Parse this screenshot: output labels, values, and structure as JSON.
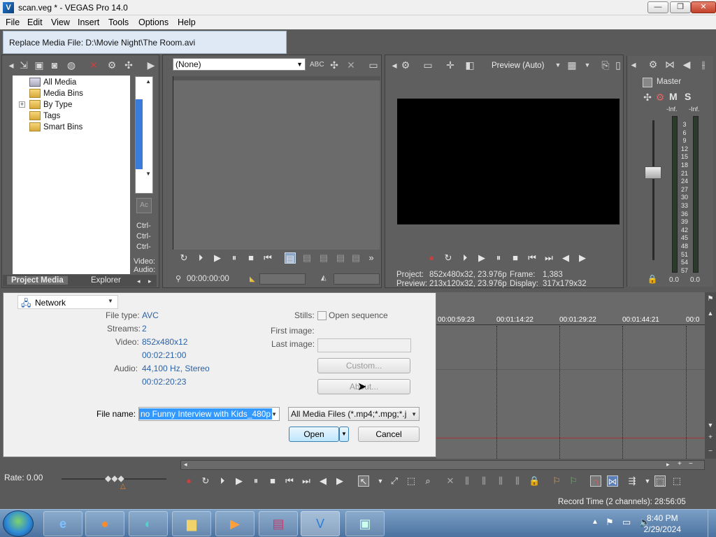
{
  "window": {
    "title": "scan.veg * - VEGAS Pro 14.0"
  },
  "menu": [
    "File",
    "Edit",
    "View",
    "Insert",
    "Tools",
    "Options",
    "Help"
  ],
  "tooltip": "Replace Media File: D:\\Movie Night\\The Room.avi",
  "media_tree": {
    "items": [
      {
        "label": "All Media",
        "selected": true
      },
      {
        "label": "Media Bins"
      },
      {
        "label": "By Type",
        "expandable": true
      },
      {
        "label": "Tags"
      },
      {
        "label": "Smart Bins"
      }
    ],
    "side_labels": [
      "Ctrl-",
      "Ctrl-",
      "Ctrl-",
      "Video:",
      "Audio:"
    ]
  },
  "panel_tabs": [
    "Project Media",
    "Explorer"
  ],
  "trimmer": {
    "dropdown": "(None)",
    "timecode": "00:00:00:00"
  },
  "preview": {
    "mode": "Preview (Auto)",
    "project_label": "Project:",
    "project_value": "852x480x32, 23.976p",
    "preview_label": "Preview:",
    "preview_value": "213x120x32, 23.976p",
    "frame_label": "Frame:",
    "frame_value": "1,383",
    "display_label": "Display:",
    "display_value": "317x179x32"
  },
  "mixer": {
    "title": "Master",
    "mute": "M",
    "solo": "S",
    "peak_left": "-Inf.",
    "peak_right": "-Inf.",
    "scale": [
      "3",
      "6",
      "9",
      "12",
      "15",
      "18",
      "21",
      "24",
      "27",
      "30",
      "33",
      "36",
      "39",
      "42",
      "45",
      "48",
      "51",
      "54",
      "57"
    ],
    "level_left": "0.0",
    "level_right": "0.0"
  },
  "dialog": {
    "location": "Network",
    "file_type_label": "File type:",
    "file_type": "AVC",
    "streams_label": "Streams:",
    "streams": "2",
    "video_label": "Video:",
    "video_res": "852x480x12",
    "video_len": "00:02:21:00",
    "audio_label": "Audio:",
    "audio_fmt": "44,100 Hz, Stereo",
    "audio_len": "00:02:20:23",
    "stills_label": "Stills:",
    "open_sequence": "Open sequence",
    "first_image_label": "First image:",
    "last_image_label": "Last image:",
    "custom_button": "Custom...",
    "about_button": "About...",
    "file_name_label": "File name:",
    "file_name_value": "no Funny Interview with Kids_480p",
    "filter": "All Media Files (*.mp4;*.mpg;*.j",
    "open_button": "Open",
    "cancel_button": "Cancel"
  },
  "timeline": {
    "ruler": [
      "00:00:59:23",
      "00:01:14:22",
      "00:01:29:22",
      "00:01:44:21",
      "00:0"
    ]
  },
  "status": {
    "rate": "Rate: 0.00",
    "record_time": "Record Time (2 channels): 28:56:05"
  },
  "taskbar": {
    "time": "8:40 PM",
    "date": "2/29/2024"
  }
}
